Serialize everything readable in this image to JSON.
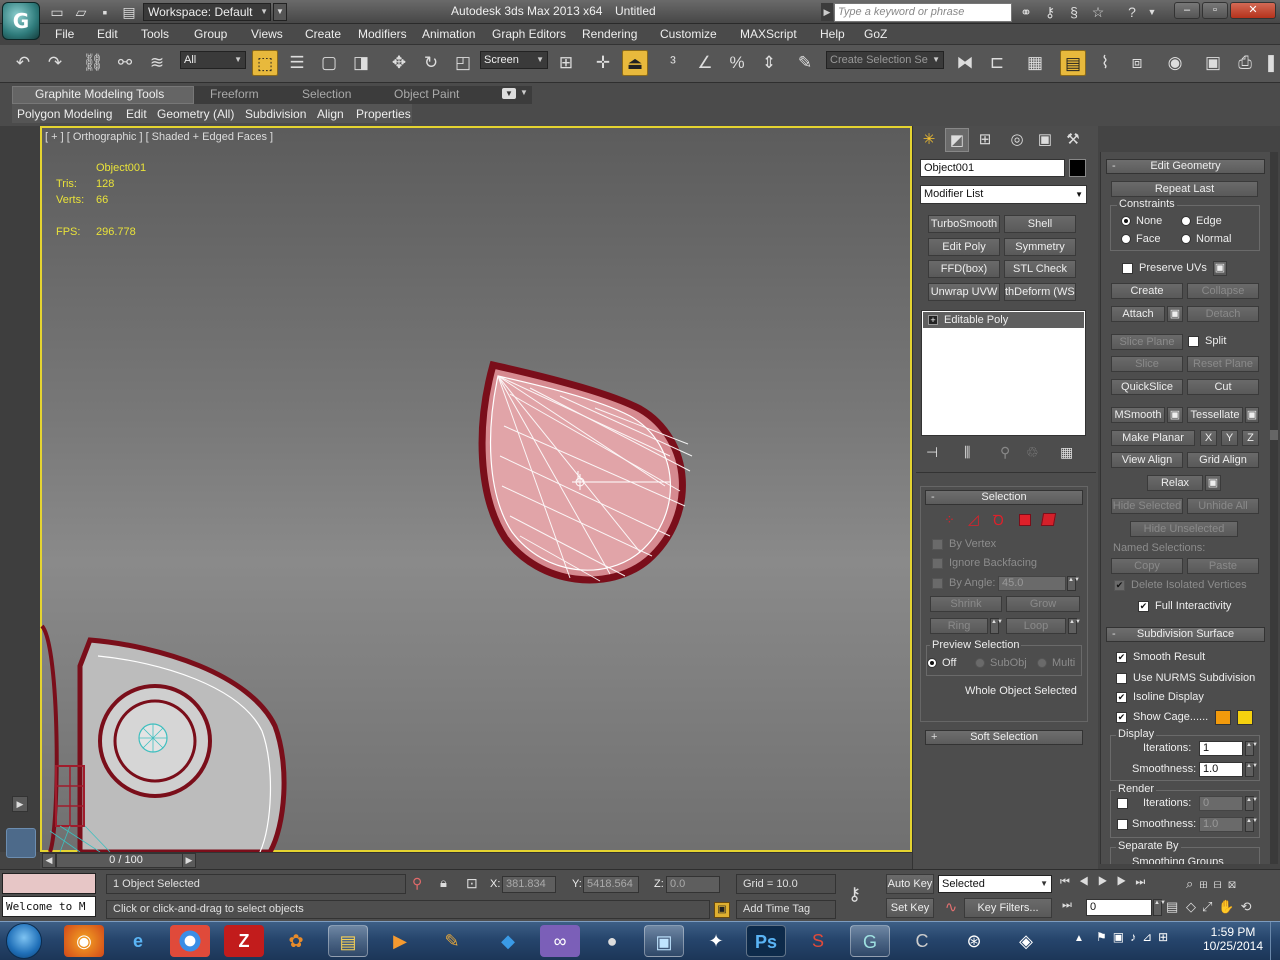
{
  "title_bar": {
    "workspace": "Workspace: Default",
    "app_title": "Autodesk 3ds Max  2013 x64",
    "document": "Untitled",
    "search_placeholder": "Type a keyword or phrase"
  },
  "menu": [
    "File",
    "Edit",
    "Tools",
    "Group",
    "Views",
    "Create",
    "Modifiers",
    "Animation",
    "Graph Editors",
    "Rendering",
    "Customize",
    "MAXScript",
    "Help",
    "GoZ"
  ],
  "toolbar": {
    "selection_filter": "All",
    "reference_coord": "Screen",
    "named_selection_placeholder": "Create Selection Se"
  },
  "ribbon": {
    "tabs": [
      "Graphite Modeling Tools",
      "Freeform",
      "Selection",
      "Object Paint"
    ],
    "subtabs": [
      "Polygon Modeling",
      "Edit",
      "Geometry (All)",
      "Subdivision",
      "Align",
      "Properties"
    ]
  },
  "viewport": {
    "label": "[ + ] [ Orthographic ] [ Shaded + Edged Faces ]",
    "stats": {
      "object_name": "Object001",
      "tris_label": "Tris:",
      "tris": "128",
      "verts_label": "Verts:",
      "verts": "66",
      "fps_label": "FPS:",
      "fps": "296.778"
    }
  },
  "time_slider": {
    "frame": "0 / 100"
  },
  "command_panel": {
    "object_name": "Object001",
    "object_color": "#000000",
    "modifier_list": "Modifier List",
    "modifier_buttons": [
      "TurboSmooth",
      "Shell",
      "Edit Poly",
      "Symmetry",
      "FFD(box)",
      "STL Check",
      "Unwrap UVW",
      "thDeform (WSI"
    ],
    "stack_item": "Editable Poly",
    "selection": {
      "title": "Selection",
      "by_vertex": "By Vertex",
      "ignore_backfacing": "Ignore Backfacing",
      "by_angle": "By Angle:",
      "angle_value": "45.0",
      "shrink": "Shrink",
      "grow": "Grow",
      "ring": "Ring",
      "loop": "Loop",
      "preview_title": "Preview Selection",
      "preview_off": "Off",
      "preview_subobj": "SubObj",
      "preview_multi": "Multi",
      "status": "Whole Object Selected"
    },
    "soft_selection_title": "Soft Selection"
  },
  "edit_geometry": {
    "title": "Edit Geometry",
    "repeat_last": "Repeat Last",
    "constraints_title": "Constraints",
    "c_none": "None",
    "c_edge": "Edge",
    "c_face": "Face",
    "c_normal": "Normal",
    "preserve_uvs": "Preserve UVs",
    "create": "Create",
    "collapse": "Collapse",
    "attach": "Attach",
    "detach": "Detach",
    "slice_plane": "Slice Plane",
    "split": "Split",
    "slice": "Slice",
    "reset_plane": "Reset Plane",
    "quickslice": "QuickSlice",
    "cut": "Cut",
    "msmooth": "MSmooth",
    "tessellate": "Tessellate",
    "make_planar": "Make Planar",
    "x": "X",
    "y": "Y",
    "z": "Z",
    "view_align": "View Align",
    "grid_align": "Grid Align",
    "relax": "Relax",
    "hide_selected": "Hide Selected",
    "unhide_all": "Unhide All",
    "hide_unselected": "Hide Unselected",
    "named_selections": "Named Selections:",
    "copy": "Copy",
    "paste": "Paste",
    "delete_isolated": "Delete Isolated Vertices",
    "full_interactivity": "Full Interactivity"
  },
  "subdivision_surface": {
    "title": "Subdivision Surface",
    "smooth_result": "Smooth Result",
    "use_nurms": "Use NURMS Subdivision",
    "isoline_display": "Isoline Display",
    "show_cage": "Show Cage......",
    "cage_color_1": "#f29a0c",
    "cage_color_2": "#f5d10f",
    "display_title": "Display",
    "iterations_label": "Iterations:",
    "display_iterations": "1",
    "smoothness_label": "Smoothness:",
    "display_smoothness": "1.0",
    "render_title": "Render",
    "render_iterations": "0",
    "render_smoothness": "1.0",
    "separate_by": "Separate By",
    "smoothing_groups": "Smoothing Groups"
  },
  "status": {
    "listener": "Welcome to M",
    "selected": "1 Object Selected",
    "prompt": "Click or click-and-drag to select objects",
    "x_label": "X:",
    "x": "381.834",
    "y_label": "Y:",
    "y": "5418.564",
    "z_label": "Z:",
    "z": "0.0",
    "grid": "Grid = 10.0",
    "add_time_tag": "Add Time Tag",
    "auto_key": "Auto Key",
    "set_key": "Set Key",
    "key_mode": "Selected",
    "key_filters": "Key Filters...",
    "frame": "0"
  },
  "taskbar": {
    "time": "1:59 PM",
    "date": "10/25/2014"
  }
}
